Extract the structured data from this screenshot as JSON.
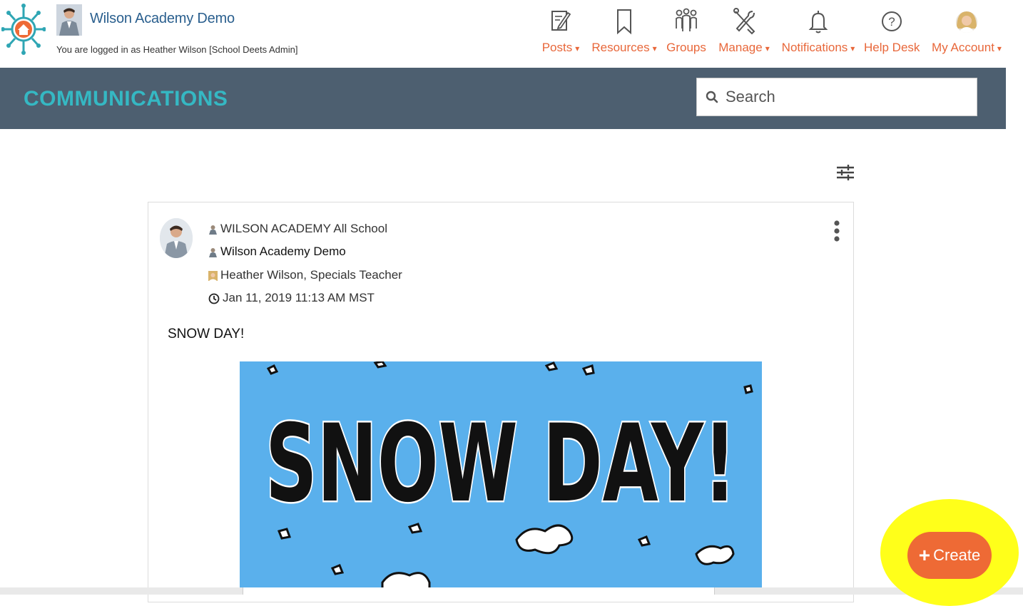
{
  "header": {
    "school_name": "Wilson Academy Demo",
    "logged_in_text": "You are logged in as Heather Wilson [School Deets Admin]"
  },
  "nav": {
    "posts": "Posts",
    "resources": "Resources",
    "groups": "Groups",
    "manage": "Manage",
    "notifications": "Notifications",
    "help_desk": "Help Desk",
    "my_account": "My Account",
    "caret": "▾"
  },
  "banner": {
    "title": "COMMUNICATIONS",
    "search_placeholder": "Search"
  },
  "post": {
    "group": "WILSON ACADEMY All School",
    "school": "Wilson Academy Demo",
    "author": "Heather Wilson, Specials Teacher",
    "timestamp": "Jan 11, 2019 11:13 AM MST",
    "text": "SNOW DAY!",
    "image_text": "SNOW DAY!"
  },
  "create_button": {
    "label": "Create"
  },
  "colors": {
    "accent": "#ee6a35",
    "banner": "#4d5f70",
    "banner_title": "#35b8c3",
    "highlight": "#ffff1a",
    "image_sky": "#5ab0ec"
  }
}
